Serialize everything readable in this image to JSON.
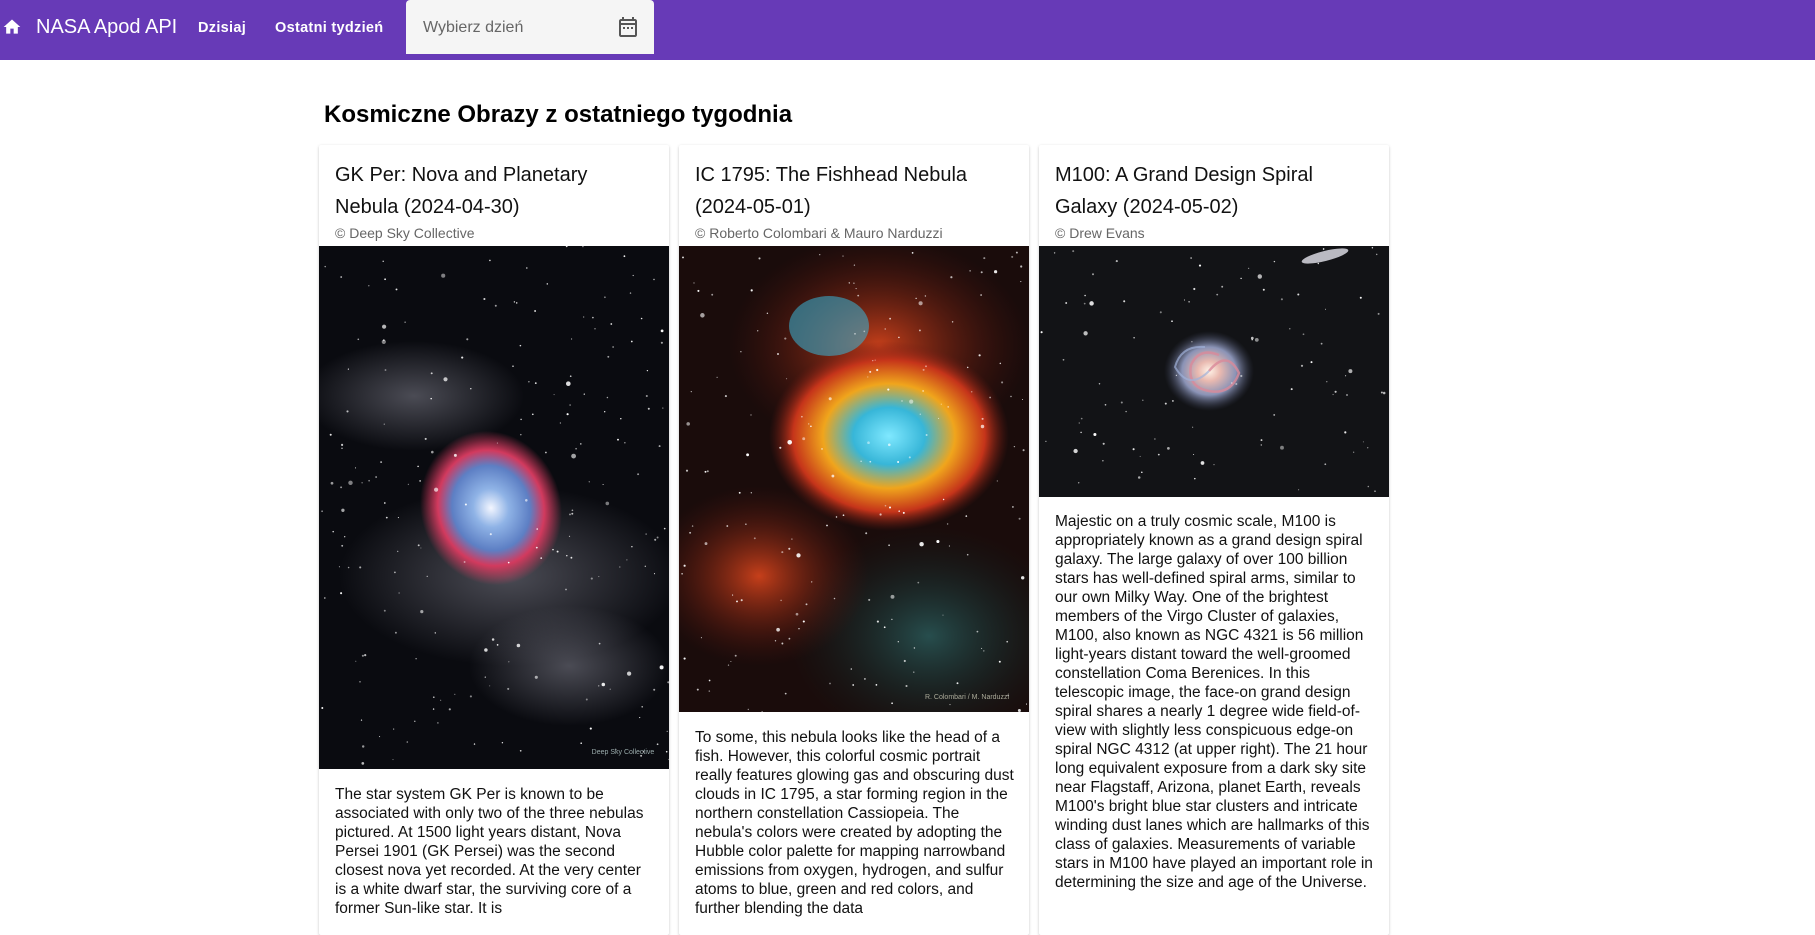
{
  "toolbar": {
    "brand": "NASA Apod API",
    "links": [
      "Dzisiaj",
      "Ostatni tydzień"
    ],
    "date_placeholder": "Wybierz dzień"
  },
  "page": {
    "heading": "Kosmiczne Obrazy z ostatniego tygodnia"
  },
  "cards": [
    {
      "title": "GK Per: Nova and Planetary Nebula (2024-04-30)",
      "credit": "© Deep Sky Collective",
      "watermark": "Deep Sky Collective",
      "text": "The star system GK Per is known to be associated with only two of the three nebulas pictured. At 1500 light years distant, Nova Persei 1901 (GK Persei) was the second closest nova yet recorded. At the very center is a white dwarf star, the surviving core of a former Sun-like star. It is"
    },
    {
      "title": "IC 1795: The Fishhead Nebula (2024-05-01)",
      "credit": "© Roberto Colombari & Mauro Narduzzi",
      "watermark": "R. Colombari / M. Narduzzi",
      "text": "To some, this nebula looks like the head of a fish. However, this colorful cosmic portrait really features glowing gas and obscuring dust clouds in IC 1795, a star forming region in the northern constellation Cassiopeia. The nebula's colors were created by adopting the Hubble color palette for mapping narrowband emissions from oxygen, hydrogen, and sulfur atoms to blue, green and red colors, and further blending the data"
    },
    {
      "title": "M100: A Grand Design Spiral Galaxy (2024-05-02)",
      "credit": "© Drew Evans",
      "watermark": "",
      "text": "Majestic on a truly cosmic scale, M100 is appropriately known as a grand design spiral galaxy. The large galaxy of over 100 billion stars has well-defined spiral arms, similar to our own Milky Way. One of the brightest members of the Virgo Cluster of galaxies, M100, also known as NGC 4321 is 56 million light-years distant toward the well-groomed constellation Coma Berenices. In this telescopic image, the face-on grand design spiral shares a nearly 1 degree wide field-of-view with slightly less conspicuous edge-on spiral NGC 4312 (at upper right). The 21 hour long equivalent exposure from a dark sky site near Flagstaff, Arizona, planet Earth, reveals M100's bright blue star clusters and intricate winding dust lanes which are hallmarks of this class of galaxies. Measurements of variable stars in M100 have played an important role in determining the size and age of the Universe."
    }
  ],
  "icons": {
    "home": "home-icon",
    "calendar": "calendar-icon"
  },
  "colors": {
    "toolbar": "#673ab7",
    "background": "#ffffff"
  }
}
